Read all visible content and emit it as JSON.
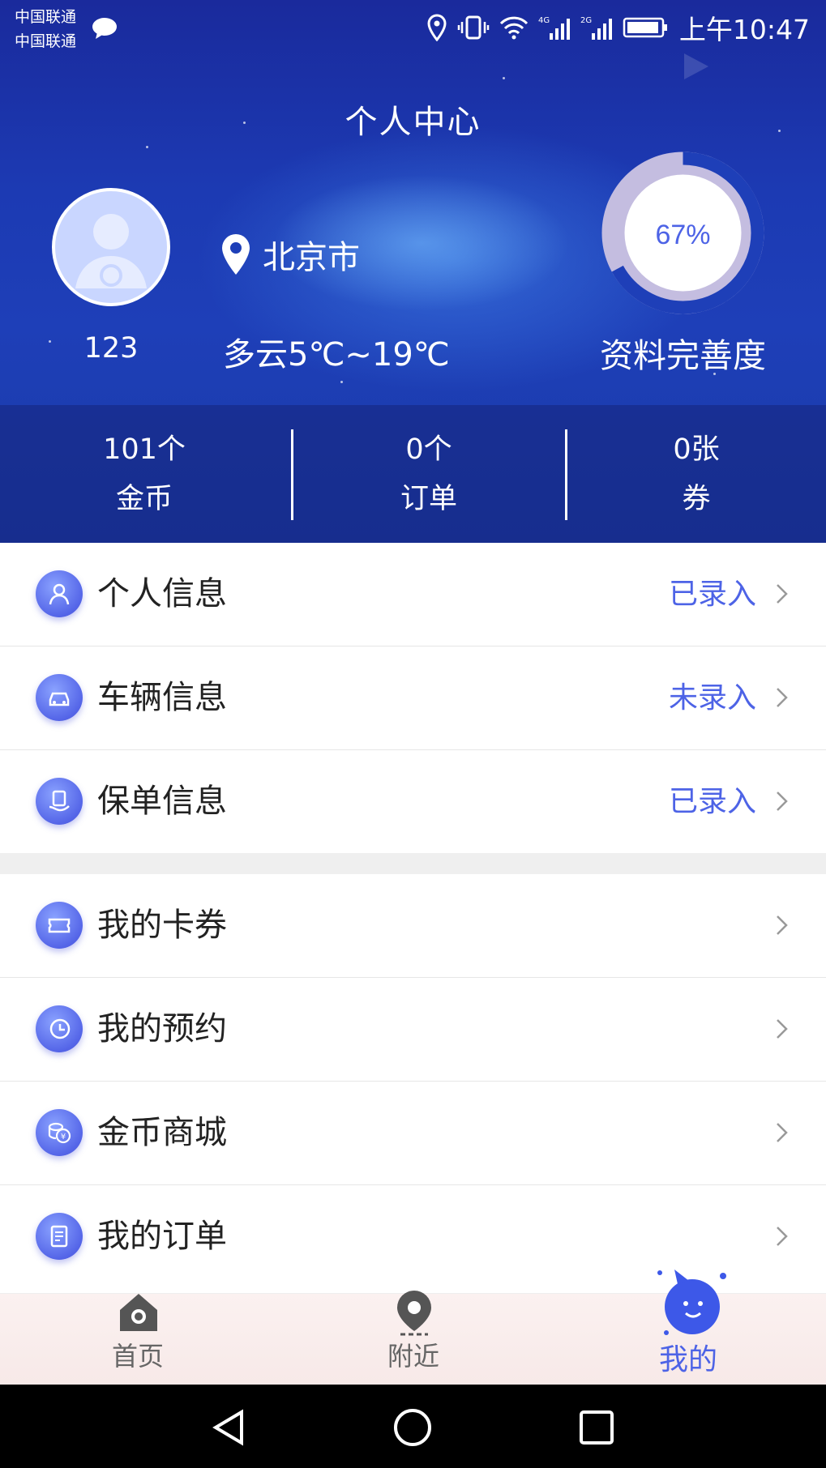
{
  "statusbar": {
    "carrier1": "中国联通",
    "carrier2": "中国联通",
    "time": "上午10:47",
    "icons": [
      "message-icon",
      "location-icon",
      "vibrate-icon",
      "wifi-icon",
      "signal-4g-icon",
      "signal-2g-icon",
      "battery-icon"
    ]
  },
  "header": {
    "title": "个人中心",
    "username": "123",
    "location": "北京市",
    "weather": "多云5℃~19℃",
    "completion_percent": 67,
    "completion_text": "67%",
    "completion_label": "资料完善度"
  },
  "stats": [
    {
      "value": "101个",
      "label": "金币"
    },
    {
      "value": "0个",
      "label": "订单"
    },
    {
      "value": "0张",
      "label": "券"
    }
  ],
  "info_rows": [
    {
      "label": "个人信息",
      "status": "已录入",
      "icon": "person-icon"
    },
    {
      "label": "车辆信息",
      "status": "未录入",
      "icon": "car-icon"
    },
    {
      "label": "保单信息",
      "status": "已录入",
      "icon": "policy-icon"
    }
  ],
  "menu_rows": [
    {
      "label": "我的卡券",
      "icon": "ticket-icon"
    },
    {
      "label": "我的预约",
      "icon": "clock-icon"
    },
    {
      "label": "金币商城",
      "icon": "coins-icon"
    },
    {
      "label": "我的订单",
      "icon": "order-icon"
    }
  ],
  "nav": {
    "home": "首页",
    "nearby": "附近",
    "mine": "我的"
  },
  "colors": {
    "accent": "#4d63e6",
    "header_bg": "#1c3ab3"
  }
}
